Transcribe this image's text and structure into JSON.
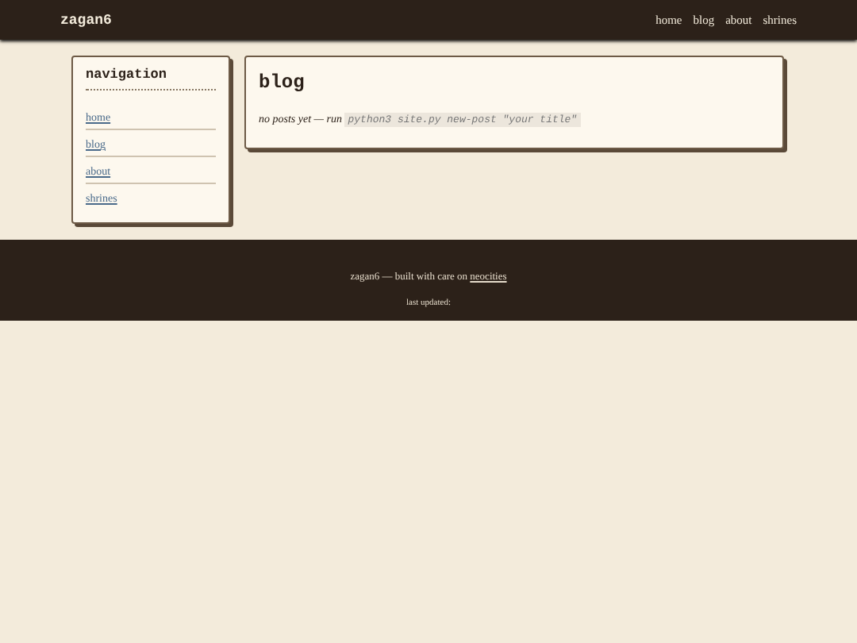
{
  "header": {
    "site_title": "zagan6",
    "nav": [
      "home",
      "blog",
      "about",
      "shrines"
    ]
  },
  "sidebar": {
    "title": "navigation",
    "items": [
      "home",
      "blog",
      "about",
      "shrines"
    ]
  },
  "main": {
    "title": "blog",
    "message": "no posts yet — run",
    "command": "python3 site.py new-post \"your title\""
  },
  "footer": {
    "text": "zagan6 — built with care on",
    "link": "neocities",
    "updated": "last updated:"
  }
}
